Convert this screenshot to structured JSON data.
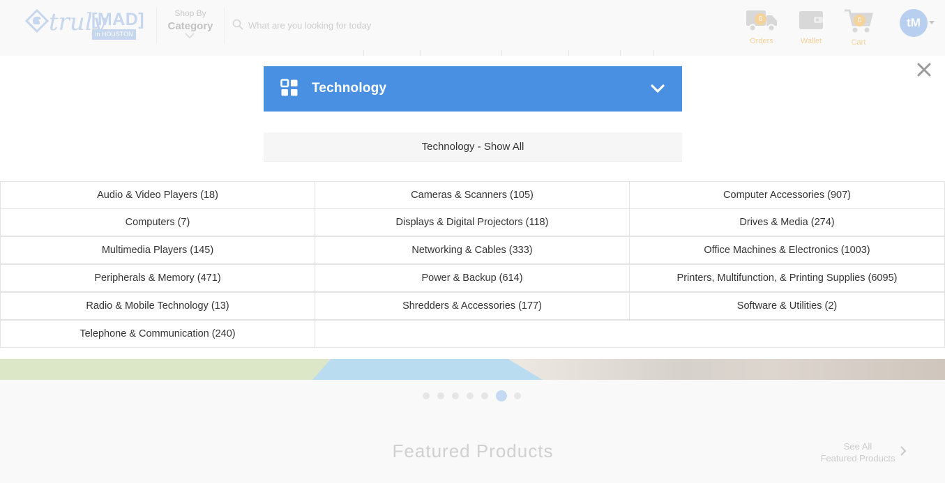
{
  "header": {
    "logo": {
      "script": "truly",
      "brand": "[MAD]",
      "city": "in HOUSTON"
    },
    "shop_by": {
      "small": "Shop By",
      "big": "Category"
    },
    "search": {
      "placeholder": "What are you looking for today"
    },
    "orders": {
      "label": "Orders",
      "count": "0"
    },
    "wallet": {
      "label": "Wallet"
    },
    "cart": {
      "label": "Cart",
      "count": "0"
    },
    "avatar": {
      "initials": "tM"
    }
  },
  "category_menu": {
    "selected": "Technology",
    "show_all": "Technology - Show All",
    "subcategories": [
      [
        "Audio & Video Players (18)",
        "Cameras & Scanners (105)",
        "Computer Accessories (907)"
      ],
      [
        "Computers (7)",
        "Displays & Digital Projectors (118)",
        "Drives & Media (274)"
      ],
      [
        "Multimedia Players (145)",
        "Networking & Cables (333)",
        "Office Machines & Electronics (1003)"
      ],
      [
        "Peripherals & Memory (471)",
        "Power & Backup (614)",
        "Printers, Multifunction, & Printing Supplies (6095)"
      ],
      [
        "Radio & Mobile Technology (13)",
        "Shredders & Accessories (177)",
        "Software & Utilities (2)"
      ],
      [
        "Telephone & Communication (240)"
      ]
    ]
  },
  "carousel": {
    "slide_count": 7,
    "active_index": 5
  },
  "featured": {
    "title": "Featured Products",
    "see_all_line1": "See All",
    "see_all_line2": "Featured Products"
  },
  "colors": {
    "accent": "#4a90e2",
    "badge": "#f5d29a",
    "avatar": "#b8cfef"
  },
  "icons": [
    "logo-hand-icon",
    "chevron-down-icon",
    "search-icon",
    "truck-icon",
    "wallet-icon",
    "cart-icon",
    "close-icon",
    "grid-icon",
    "chevron-right-icon"
  ]
}
